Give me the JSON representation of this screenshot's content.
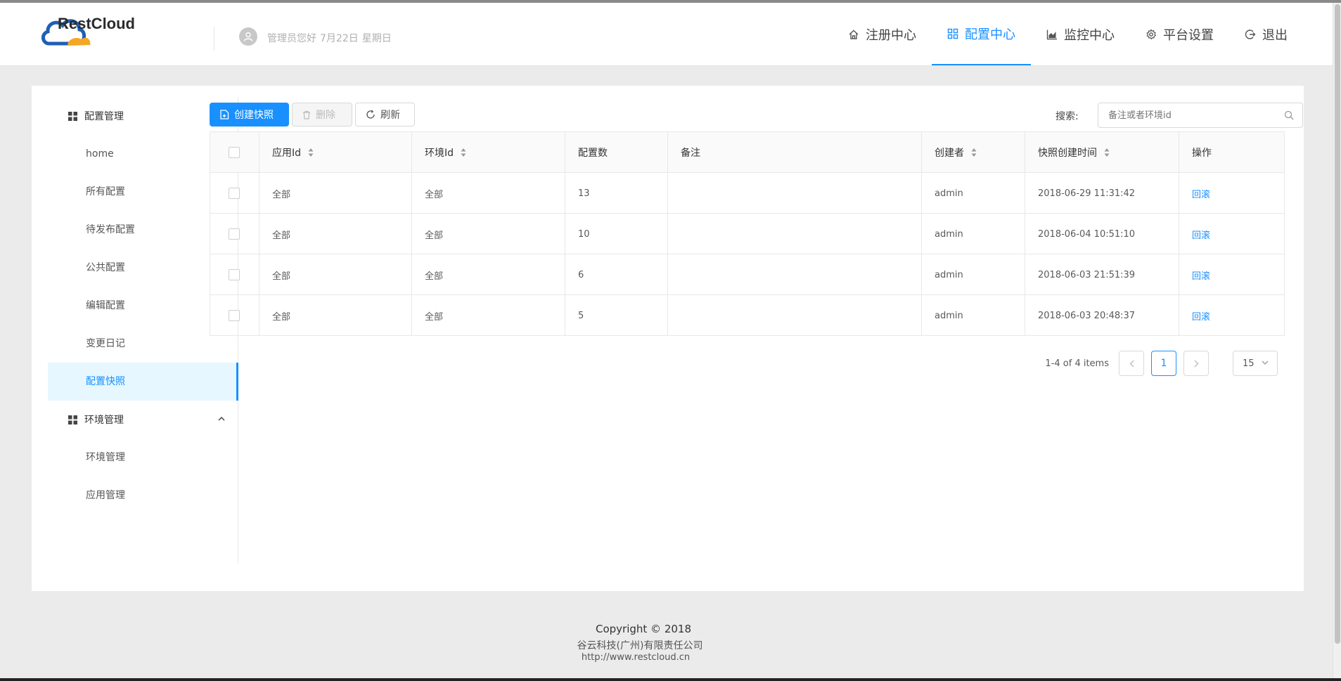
{
  "brand": {
    "name": "RestCloud"
  },
  "user": {
    "role": "管理员",
    "greeting": "您好",
    "date": "7月22日",
    "weekday": "星期日"
  },
  "nav": [
    {
      "label": "注册中心",
      "icon": "home-icon"
    },
    {
      "label": "配置中心",
      "icon": "grid-icon",
      "active": true
    },
    {
      "label": "监控中心",
      "icon": "area-chart-icon"
    },
    {
      "label": "平台设置",
      "icon": "gear-icon"
    },
    {
      "label": "退出",
      "icon": "logout-icon"
    }
  ],
  "sidebar": {
    "groups": [
      {
        "label": "配置管理",
        "items": [
          {
            "label": "home"
          },
          {
            "label": "所有配置"
          },
          {
            "label": "待发布配置"
          },
          {
            "label": "公共配置"
          },
          {
            "label": "编辑配置"
          },
          {
            "label": "变更日记"
          },
          {
            "label": "配置快照",
            "active": true
          }
        ]
      },
      {
        "label": "环境管理",
        "items": [
          {
            "label": "环境管理"
          },
          {
            "label": "应用管理"
          }
        ]
      }
    ]
  },
  "toolbar": {
    "create_label": "创建快照",
    "delete_label": "删除",
    "refresh_label": "刷新",
    "search_label": "搜索:",
    "search_placeholder": "备注或者环境id",
    "search_value": ""
  },
  "table": {
    "columns": [
      "应用Id",
      "环境Id",
      "配置数",
      "备注",
      "创建者",
      "快照创建时间",
      "操作"
    ],
    "rows": [
      {
        "app": "全部",
        "env": "全部",
        "count": "13",
        "note": "",
        "creator": "admin",
        "time": "2018-06-29 11:31:42",
        "action": "回滚"
      },
      {
        "app": "全部",
        "env": "全部",
        "count": "10",
        "note": "",
        "creator": "admin",
        "time": "2018-06-04 10:51:10",
        "action": "回滚"
      },
      {
        "app": "全部",
        "env": "全部",
        "count": "6",
        "note": "",
        "creator": "admin",
        "time": "2018-06-03 21:51:39",
        "action": "回滚"
      },
      {
        "app": "全部",
        "env": "全部",
        "count": "5",
        "note": "",
        "creator": "admin",
        "time": "2018-06-03 20:48:37",
        "action": "回滚"
      }
    ]
  },
  "pagination": {
    "total_text": "1-4 of 4 items",
    "current_page": "1",
    "page_size": "15"
  },
  "footer": {
    "copyright": "Copyright © 2018",
    "company": "谷云科技(广州)有限责任公司",
    "url": "http://www.restcloud.cn"
  },
  "colors": {
    "primary": "#1890ff",
    "sidebar_active_bg": "#e6f7ff",
    "page_bg": "#ebebeb"
  }
}
